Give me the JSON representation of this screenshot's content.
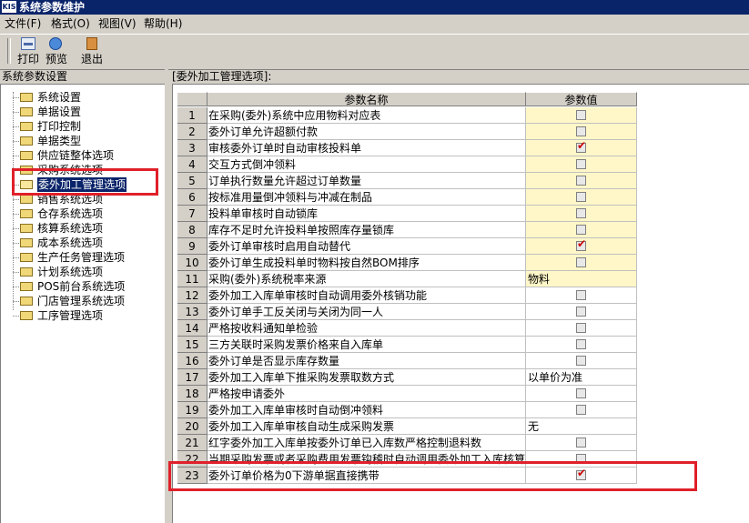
{
  "window": {
    "title": "系统参数维护",
    "icon_text": "KIS"
  },
  "menu": [
    "文件(F)",
    "格式(O)",
    "视图(V)",
    "帮助(H)"
  ],
  "toolbar": {
    "print": "打印",
    "preview": "预览",
    "exit": "退出"
  },
  "left_panel": {
    "title": "系统参数设置",
    "items": [
      "系统设置",
      "单据设置",
      "打印控制",
      "单据类型",
      "供应链整体选项",
      "采购系统选项",
      "委外加工管理选项",
      "销售系统选项",
      "仓存系统选项",
      "核算系统选项",
      "成本系统选项",
      "生产任务管理选项",
      "计划系统选项",
      "POS前台系统选项",
      "门店管理系统选项",
      "工序管理选项"
    ],
    "selected": "委外加工管理选项"
  },
  "right_panel": {
    "title": "[委外加工管理选项]:",
    "headers": {
      "name": "参数名称",
      "value": "参数值"
    },
    "rows": [
      {
        "no": "1",
        "name": "在采购(委外)系统中应用物料对应表",
        "type": "check",
        "checked": false,
        "yellow": true
      },
      {
        "no": "2",
        "name": "委外订单允许超额付款",
        "type": "check",
        "checked": false,
        "yellow": true
      },
      {
        "no": "3",
        "name": "审核委外订单时自动审核投料单",
        "type": "check",
        "checked": true,
        "yellow": true
      },
      {
        "no": "4",
        "name": "交互方式倒冲领料",
        "type": "check",
        "checked": false,
        "yellow": true
      },
      {
        "no": "5",
        "name": "订单执行数量允许超过订单数量",
        "type": "check",
        "checked": false,
        "yellow": true
      },
      {
        "no": "6",
        "name": "按标准用量倒冲领料与冲减在制品",
        "type": "check",
        "checked": false,
        "yellow": true
      },
      {
        "no": "7",
        "name": "投料单审核时自动锁库",
        "type": "check",
        "checked": false,
        "yellow": true
      },
      {
        "no": "8",
        "name": "库存不足时允许投料单按照库存量锁库",
        "type": "check",
        "checked": false,
        "yellow": true
      },
      {
        "no": "9",
        "name": "委外订单审核时启用自动替代",
        "type": "check",
        "checked": true,
        "yellow": true
      },
      {
        "no": "10",
        "name": "委外订单生成投料单时物料按自然BOM排序",
        "type": "check",
        "checked": false,
        "yellow": true
      },
      {
        "no": "11",
        "name": "采购(委外)系统税率来源",
        "type": "text",
        "value": "物料",
        "yellow": true
      },
      {
        "no": "12",
        "name": "委外加工入库单审核时自动调用委外核销功能",
        "type": "check",
        "checked": false,
        "yellow": false
      },
      {
        "no": "13",
        "name": "委外订单手工反关闭与关闭为同一人",
        "type": "check",
        "checked": false,
        "yellow": false
      },
      {
        "no": "14",
        "name": "严格按收料通知单检验",
        "type": "check",
        "checked": false,
        "yellow": false
      },
      {
        "no": "15",
        "name": "三方关联时采购发票价格来自入库单",
        "type": "check",
        "checked": false,
        "yellow": false
      },
      {
        "no": "16",
        "name": "委外订单是否显示库存数量",
        "type": "check",
        "checked": false,
        "yellow": false
      },
      {
        "no": "17",
        "name": "委外加工入库单下推采购发票取数方式",
        "type": "text",
        "value": "以单价为准",
        "yellow": false
      },
      {
        "no": "18",
        "name": "严格按申请委外",
        "type": "check",
        "checked": false,
        "yellow": false
      },
      {
        "no": "19",
        "name": "委外加工入库单审核时自动倒冲领料",
        "type": "check",
        "checked": false,
        "yellow": false
      },
      {
        "no": "20",
        "name": "委外加工入库单审核自动生成采购发票",
        "type": "text",
        "value": "无",
        "yellow": false
      },
      {
        "no": "21",
        "name": "红字委外加工入库单按委外订单已入库数严格控制退料数",
        "type": "check",
        "checked": false,
        "yellow": false
      },
      {
        "no": "22",
        "name": "当期采购发票或者采购费用发票钩稽时自动调用委外加工入库核算",
        "type": "check",
        "checked": false,
        "yellow": false
      },
      {
        "no": "23",
        "name": "委外订单价格为0下游单据直接携带",
        "type": "check",
        "checked": true,
        "yellow": false
      }
    ]
  },
  "colors": {
    "title_bg": "#0a246a",
    "highlight": "#e0202a",
    "yellow_cell": "#fff7c8",
    "check": "#cc0000"
  }
}
